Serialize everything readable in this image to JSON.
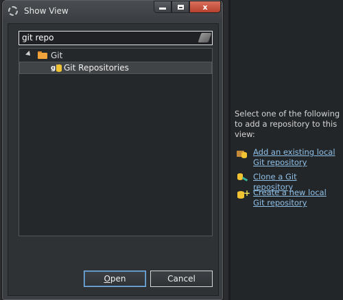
{
  "dialog": {
    "title": "Show View",
    "search_value": "git repo",
    "tree": [
      {
        "label": "Git"
      },
      {
        "label": "Git Repositories"
      }
    ],
    "open_label_first": "O",
    "open_label_rest": "pen",
    "cancel_label": "Cancel",
    "close_glyph": "x"
  },
  "repo_panel": {
    "intro": "Select one of the following to add a repository to this view:",
    "actions": [
      {
        "label": "Add an existing local Git repository",
        "icon": "add-existing-repo-icon"
      },
      {
        "label": "Clone a Git repository",
        "icon": "clone-repo-icon"
      },
      {
        "label": "Create a new local Git repository",
        "icon": "create-repo-icon"
      }
    ]
  },
  "colors": {
    "link": "#8fc0e8",
    "accent": "#f1c232"
  }
}
